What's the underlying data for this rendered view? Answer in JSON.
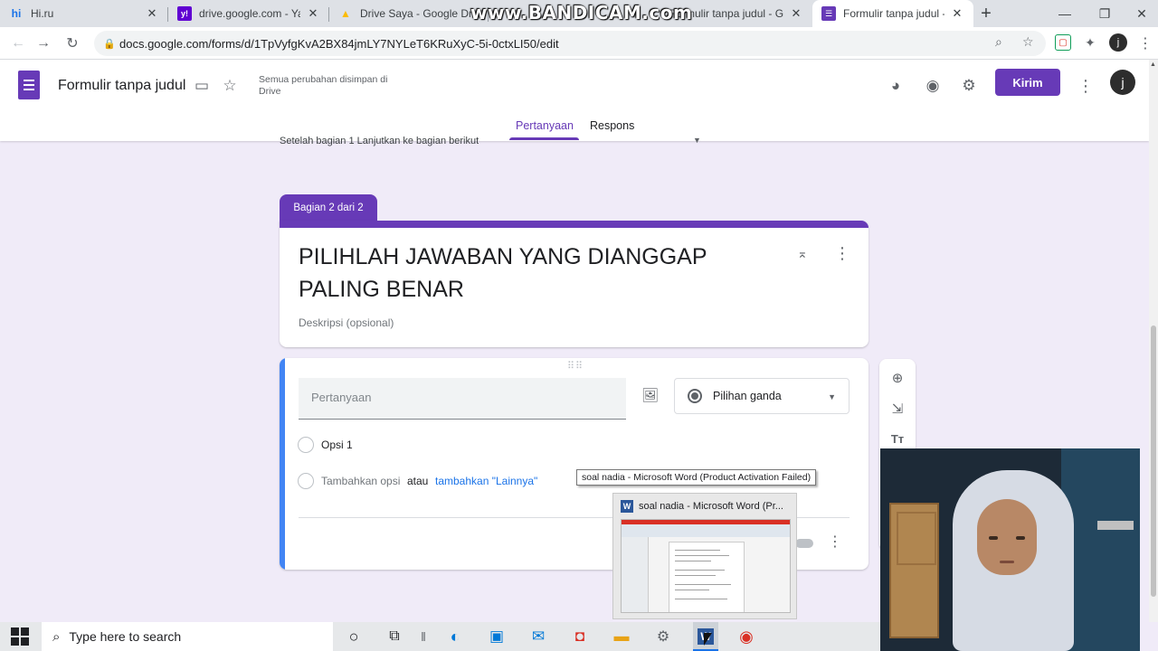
{
  "browser": {
    "tabs": [
      {
        "label": "Hi.ru",
        "favicon": "hi-icon",
        "favicon_char": "hi",
        "favicon_color": "#1a73e8"
      },
      {
        "label": "drive.google.com - Yah",
        "favicon": "yahoo-icon",
        "favicon_char": "y!",
        "favicon_color": "#6001d2"
      },
      {
        "label": "Drive Saya - Google Dr",
        "favicon": "google-drive-icon",
        "favicon_char": "▲",
        "favicon_color": "#fbbc04"
      },
      {
        "label": "Formulir tanpa judul - G",
        "favicon": "google-forms-icon",
        "favicon_char": "☰",
        "favicon_color": "#673ab7"
      },
      {
        "label": "Formulir tanpa judul - G",
        "favicon": "google-forms-icon",
        "favicon_char": "☰",
        "favicon_color": "#673ab7",
        "active": true
      }
    ],
    "watermark": "www.BANDICAM.com",
    "url": "docs.google.com/forms/d/1TpVyfgKvA2BX84jmLY7NYLeT6KRuXyC-5i-0ctxLI50/edit",
    "profile_initial": "j"
  },
  "forms_header": {
    "title": "Formulir tanpa judul",
    "save_status": "Semua perubahan disimpan di Drive",
    "send_label": "Kirim",
    "avatar_initial": "j",
    "tabs": [
      {
        "label": "Pertanyaan",
        "active": true
      },
      {
        "label": "Respons",
        "active": false
      }
    ]
  },
  "section_nav_cutoff": "Setelah bagian 1    Lanjutkan ke bagian berikut",
  "section": {
    "badge": "Bagian 2 dari 2",
    "title": "PILIHLAH JAWABAN YANG DIANGGAP PALING BENAR",
    "description_placeholder": "Deskripsi (opsional)"
  },
  "question": {
    "placeholder": "Pertanyaan",
    "type": "Pilihan ganda",
    "options": [
      "Opsi 1"
    ],
    "add_option": "Tambahkan opsi",
    "or_text": "atau",
    "add_other": "tambahkan \"Lainnya\""
  },
  "taskbar": {
    "search_placeholder": "Type here to search",
    "tooltip": "soal nadia - Microsoft Word (Product Activation Failed)",
    "thumbnail_title": "soal nadia - Microsoft Word (Pr..."
  },
  "colors": {
    "accent": "#673ab7",
    "question_accent": "#4285f4",
    "page_bg": "#f0ebf8"
  }
}
